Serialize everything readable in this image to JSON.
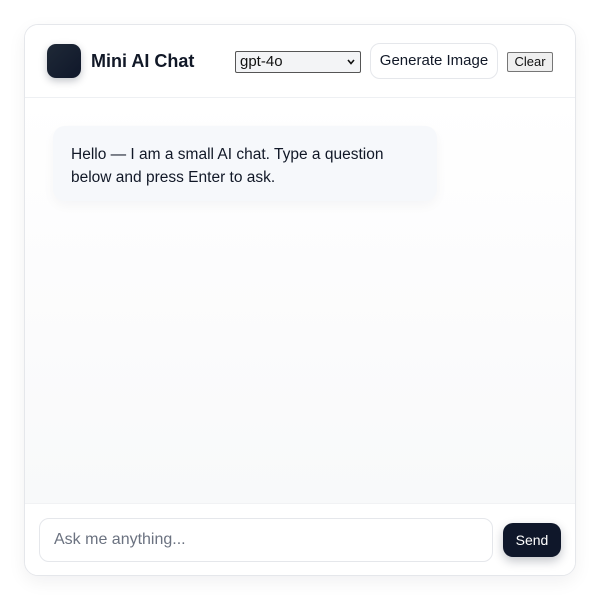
{
  "app": {
    "title": "Mini AI Chat",
    "logo_icon": "app-logo-icon"
  },
  "toolbar": {
    "model_selected": "gpt-4o",
    "generate_label": "Generate Image",
    "clear_label": "Clear"
  },
  "messages": [
    {
      "role": "assistant",
      "text": "Hello — I am a small AI chat. Type a question below and press Enter to ask."
    }
  ],
  "composer": {
    "placeholder": "Ask me anything...",
    "value": "",
    "send_label": "Send"
  },
  "colors": {
    "accent": "#0f172a",
    "bubble_bg": "#f6f8fb",
    "border": "#e5e7eb"
  }
}
